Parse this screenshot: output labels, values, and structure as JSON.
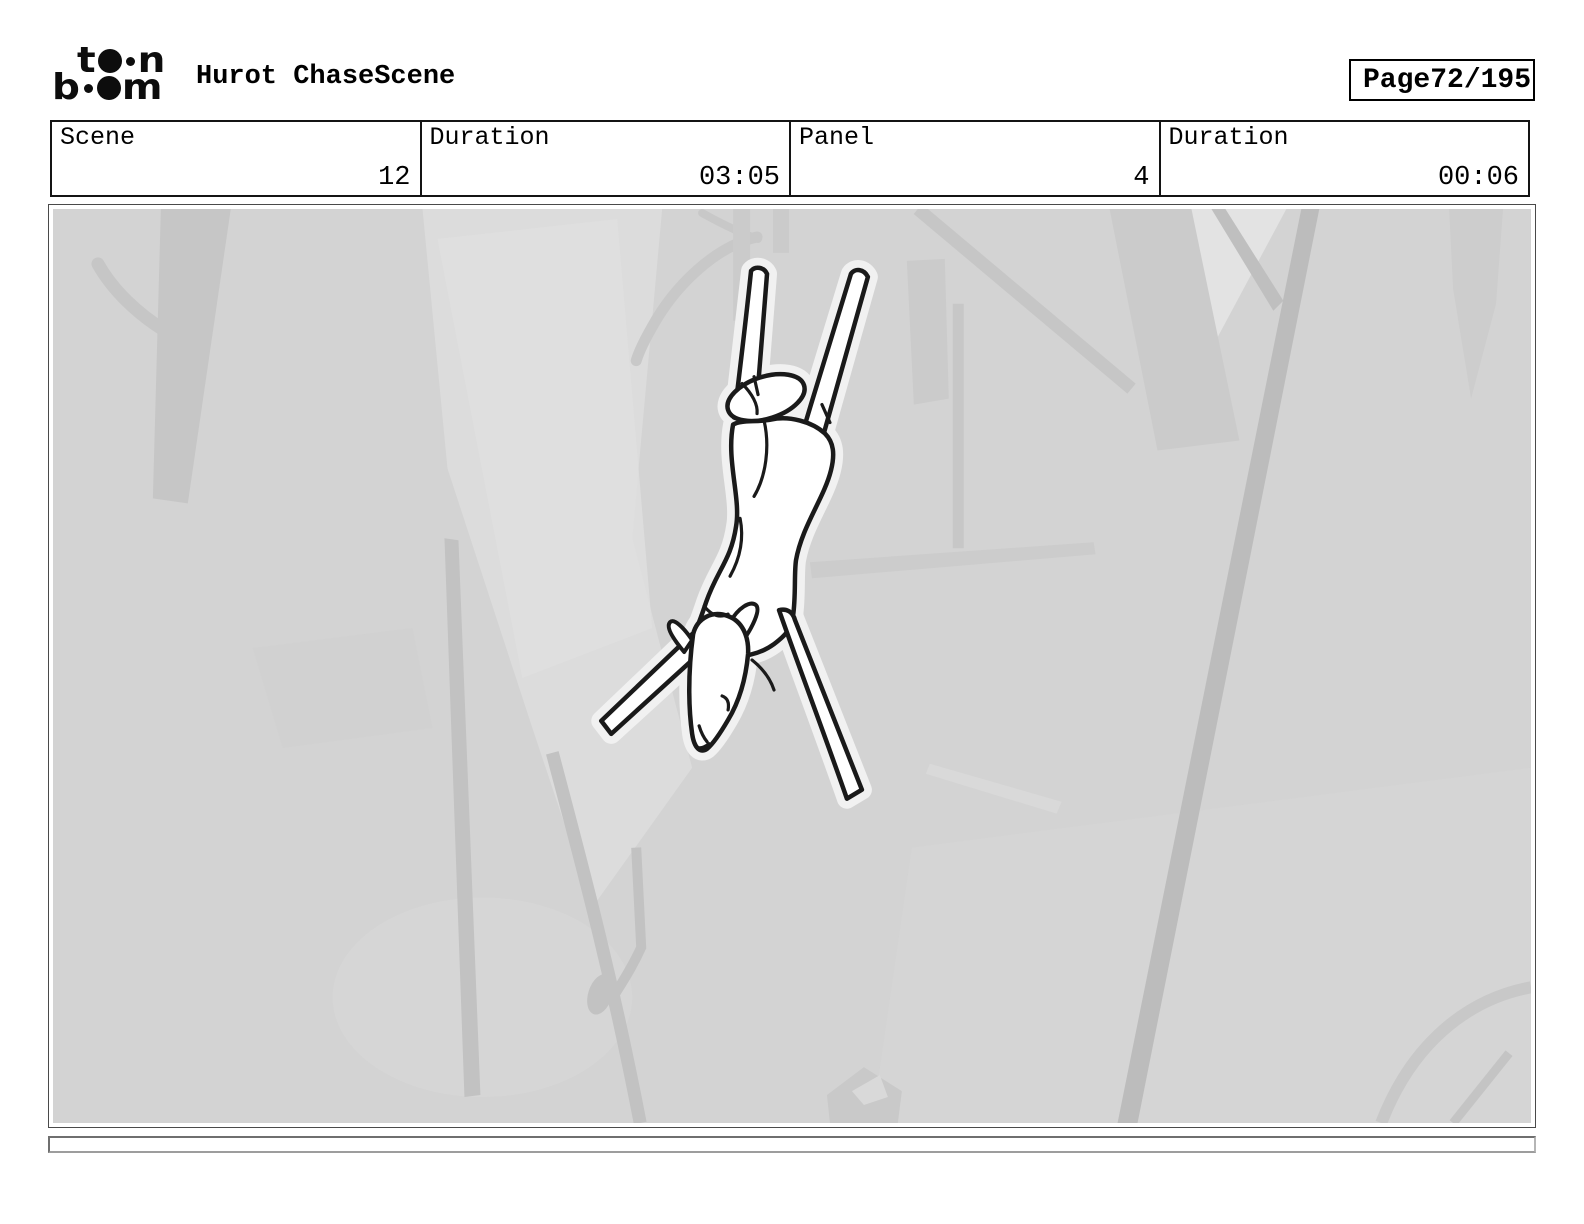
{
  "header": {
    "logo": {
      "alt": "toon boom",
      "l1a": "t",
      "l1b": "n",
      "l2a": "b",
      "l2b": "m"
    },
    "title": "Hurot ChaseScene",
    "page_label": "Page",
    "page_value": "72/195"
  },
  "info_row": {
    "cells": [
      {
        "label": "Scene",
        "value": "12"
      },
      {
        "label": "Duration",
        "value": "03:05"
      },
      {
        "label": "Panel",
        "value": "4"
      },
      {
        "label": "Duration",
        "value": "00:06"
      }
    ]
  },
  "panel": {
    "description": "Sketch of a fawn leaping head-first downward through an abstract grey forest",
    "caption_text": ""
  },
  "colors": {
    "ink": "#000000",
    "panel_background": "#d3d3d3",
    "trunk_dark": "#bcbcbc",
    "trunk_mid": "#c6c6c6",
    "trunk_light": "#cbcbcb",
    "highlight": "#e0e0e0",
    "deer_fill": "#ffffff",
    "deer_line": "#1a1a1a"
  }
}
